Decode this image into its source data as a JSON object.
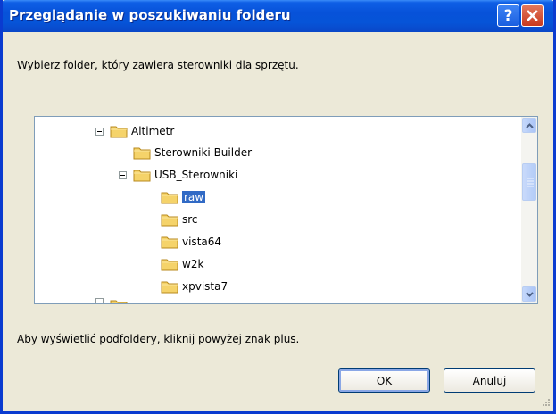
{
  "window": {
    "title": "Przeglądanie w poszukiwaniu folderu",
    "help_label": "?"
  },
  "instruction": "Wybierz folder, który zawiera sterowniki dla sprzętu.",
  "tree": {
    "items": [
      {
        "label": "Altimetr",
        "expanded": true
      },
      {
        "label": "Sterowniki Builder"
      },
      {
        "label": "USB_Sterowniki",
        "expanded": true
      },
      {
        "label": "raw",
        "selected": true
      },
      {
        "label": "src"
      },
      {
        "label": "vista64"
      },
      {
        "label": "w2k"
      },
      {
        "label": "xpvista7"
      }
    ]
  },
  "hint": "Aby wyświetlić podfoldery, kliknij powyżej znak plus.",
  "buttons": {
    "ok": "OK",
    "cancel": "Anuluj"
  },
  "colors": {
    "titlebar": "#0654d8",
    "dialog_bg": "#ece9d8",
    "selection": "#316ac5",
    "close_button": "#c8391e"
  },
  "icons": [
    "help-icon",
    "close-icon",
    "folder-icon",
    "expander-minus-icon",
    "scroll-up-icon",
    "scroll-down-icon",
    "resize-grip-icon"
  ]
}
